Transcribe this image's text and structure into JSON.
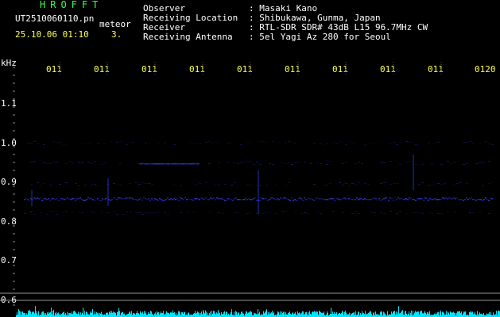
{
  "header": {
    "program": "HROFFT",
    "file": "UT2510060110.pn",
    "meteor_label": "meteor",
    "datetime": "25.10.06 01:10",
    "count": "3."
  },
  "info": {
    "observer_label": "Observer",
    "observer_value": ": Masaki Kano",
    "location_label": "Receiving Location",
    "location_value": ": Shibukawa, Gunma, Japan",
    "receiver_label": "Receiver",
    "receiver_value": ": RTL-SDR SDR# 43dB L15 96.7MHz CW",
    "antenna_label": "Receiving Antenna",
    "antenna_value": ": 5el Yagi Az 280 for Seoul"
  },
  "axis": {
    "y_unit": "kHz",
    "y_ticks": [
      "1.1",
      "1.0",
      "0.9",
      "0.8",
      "0.7",
      "0.6"
    ],
    "x_ticks": [
      "011",
      "011",
      "011",
      "011",
      "011",
      "011",
      "011",
      "011",
      "011",
      "0120"
    ]
  },
  "colors": {
    "background": "#000000",
    "signal": "#3344ff",
    "level": "#00e5ff",
    "text_title": "#33ff55",
    "text_ticks": "#ffff55"
  }
}
